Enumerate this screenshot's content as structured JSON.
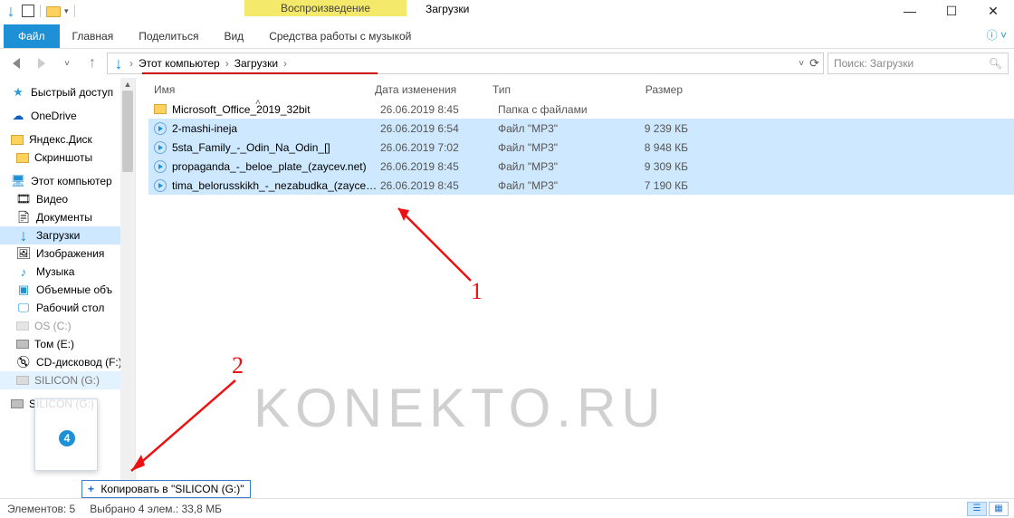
{
  "titlebar": {
    "context_tab": "Воспроизведение",
    "title": "Загрузки"
  },
  "ribbon": {
    "file": "Файл",
    "tabs": [
      "Главная",
      "Поделиться",
      "Вид",
      "Средства работы с музыкой"
    ]
  },
  "breadcrumbs": {
    "items": [
      "Этот компьютер",
      "Загрузки"
    ]
  },
  "search": {
    "placeholder": "Поиск: Загрузки"
  },
  "columns": {
    "name": "Имя",
    "date": "Дата изменения",
    "type": "Тип",
    "size": "Размер"
  },
  "sidebar": {
    "quick": "Быстрый доступ",
    "onedrive": "OneDrive",
    "yadisk": "Яндекс.Диск",
    "screenshots": "Скриншоты",
    "thispc": "Этот компьютер",
    "videos": "Видео",
    "documents": "Документы",
    "downloads": "Загрузки",
    "pictures": "Изображения",
    "music": "Музыка",
    "objects3d": "Объемные объ",
    "desktop": "Рабочий стол",
    "os": "OS (C:)",
    "drive_e": "Том (E:)",
    "cdrom": "CD-дисковод (F:)",
    "silicon_nav": "SILICON (G:)",
    "silicon_ext": "SILICON (G:)"
  },
  "files": [
    {
      "name": "Microsoft_Office_2019_32bit",
      "date": "26.06.2019 8:45",
      "type": "Папка с файлами",
      "size": "",
      "kind": "folder",
      "selected": false
    },
    {
      "name": "2-mashi-ineja",
      "date": "26.06.2019 6:54",
      "type": "Файл \"MP3\"",
      "size": "9 239 КБ",
      "kind": "mp3",
      "selected": true
    },
    {
      "name": "5sta_Family_-_Odin_Na_Odin_[]",
      "date": "26.06.2019 7:02",
      "type": "Файл \"MP3\"",
      "size": "8 948 КБ",
      "kind": "mp3",
      "selected": true
    },
    {
      "name": "propaganda_-_beloe_plate_(zaycev.net)",
      "date": "26.06.2019 8:45",
      "type": "Файл \"MP3\"",
      "size": "9 309 КБ",
      "kind": "mp3",
      "selected": true
    },
    {
      "name": "tima_belorusskikh_-_nezabudka_(zaycev....",
      "date": "26.06.2019 8:45",
      "type": "Файл \"MP3\"",
      "size": "7 190 КБ",
      "kind": "mp3",
      "selected": true
    }
  ],
  "drag": {
    "count": "4",
    "tip_prefix": "+",
    "tip": "Копировать в \"SILICON (G:)\""
  },
  "status": {
    "items": "Элементов: 5",
    "selected": "Выбрано 4 элем.: 33,8 МБ"
  },
  "annotations": {
    "label1": "1",
    "label2": "2"
  },
  "watermark": "KONEKTO.RU"
}
